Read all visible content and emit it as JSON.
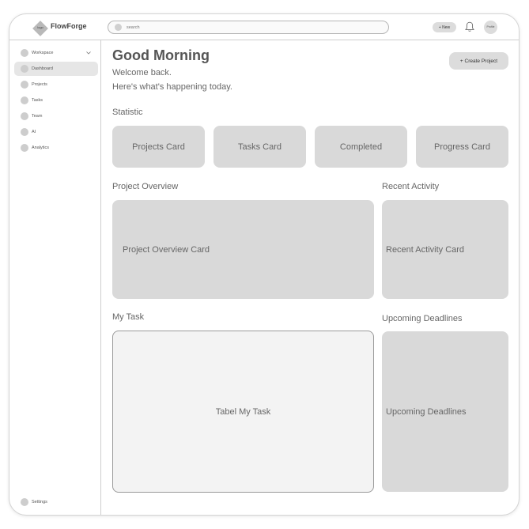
{
  "header": {
    "logo_text": "logo",
    "brand": "FlowForge",
    "search_placeholder": "search",
    "new_button": "+ New",
    "profile_label": "Profile"
  },
  "sidebar": {
    "items": [
      {
        "label": "Workspace"
      },
      {
        "label": "Dashboard"
      },
      {
        "label": "Projects"
      },
      {
        "label": "Tasks"
      },
      {
        "label": "Team"
      },
      {
        "label": "AI"
      },
      {
        "label": "Analytics"
      }
    ],
    "settings": "Settings"
  },
  "main": {
    "greeting": "Good Morning",
    "welcome": "Welcome back.",
    "subtitle": "Here's what's happening today.",
    "create_button": "+ Create Project",
    "statistic_label": "Statistic",
    "stat_cards": [
      "Projects Card",
      "Tasks Card",
      "Completed",
      "Progress Card"
    ],
    "project_overview_label": "Project Overview",
    "project_overview_card": "Project Overview Card",
    "recent_activity_label": "Recent Activity",
    "recent_activity_card": "Recent Activity Card",
    "my_task_label": "My Task",
    "my_task_table": "Tabel My Task",
    "upcoming_label": "Upcoming Deadlines",
    "upcoming_card": "Upcoming Deadlines"
  }
}
